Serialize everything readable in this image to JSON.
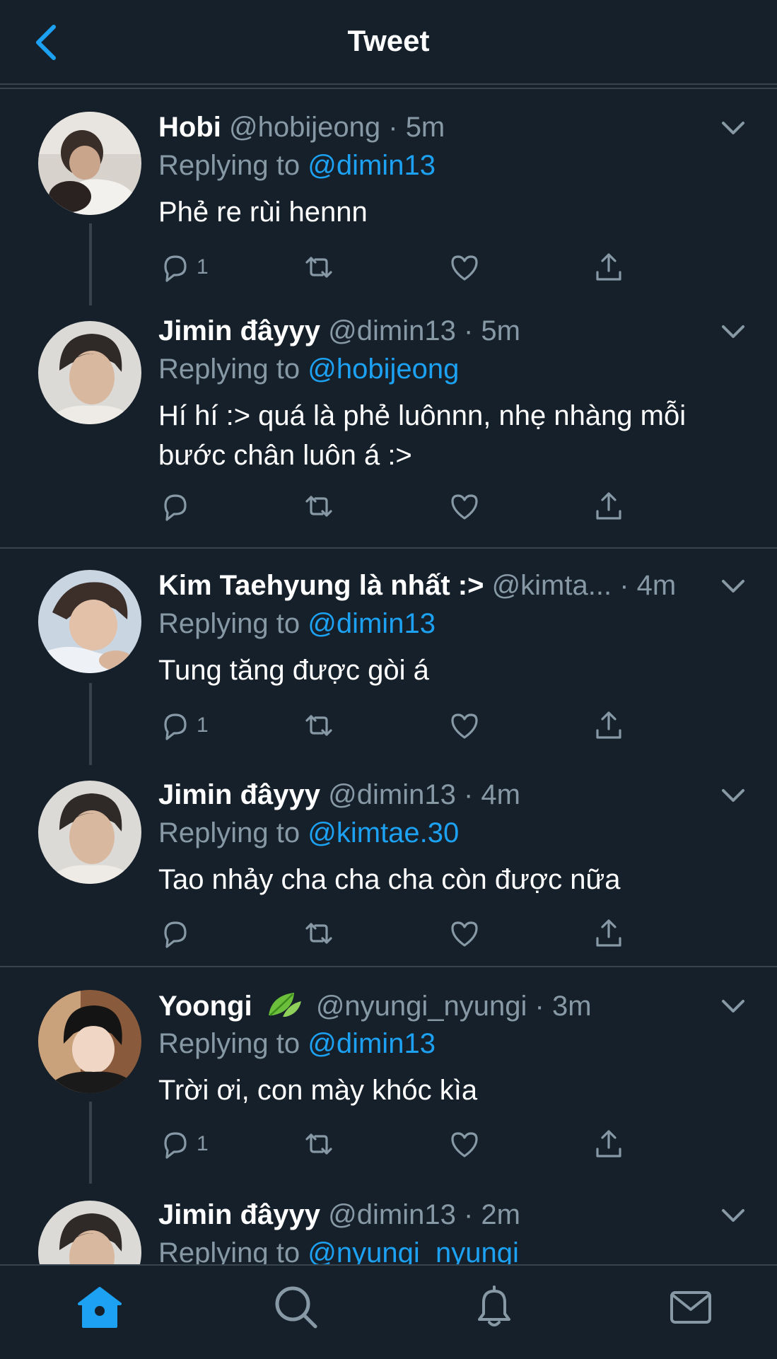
{
  "header": {
    "title": "Tweet"
  },
  "colors": {
    "background": "#15202b",
    "accent": "#1da1f2",
    "muted": "#8899a6",
    "divider": "#38444d"
  },
  "tweets": [
    {
      "name": "Hobi",
      "handle": "@hobijeong",
      "dot": "·",
      "time": "5m",
      "replying_label": "Replying to",
      "reply_to": "@dimin13",
      "text": "Phẻ re rùi hennn",
      "reply_count": "1"
    },
    {
      "name": "Jimin đâyyy",
      "handle": "@dimin13",
      "dot": "·",
      "time": "5m",
      "replying_label": "Replying to",
      "reply_to": "@hobijeong",
      "text": "Hí hí :> quá là phẻ luônnn, nhẹ nhàng mỗi bước chân luôn á :>",
      "reply_count": ""
    },
    {
      "name": "Kim Taehyung là nhất :>",
      "handle": "@kimta...",
      "dot": "·",
      "time": "4m",
      "replying_label": "Replying to",
      "reply_to": "@dimin13",
      "text": "Tung tăng được gòi á",
      "reply_count": "1"
    },
    {
      "name": "Jimin đâyyy",
      "handle": "@dimin13",
      "dot": "·",
      "time": "4m",
      "replying_label": "Replying to",
      "reply_to": "@kimtae.30",
      "text": "Tao nhảy cha cha cha còn được nữa",
      "reply_count": ""
    },
    {
      "name": "Yoongi",
      "handle": "@nyungi_nyungi",
      "dot": "·",
      "time": "3m",
      "replying_label": "Replying to",
      "reply_to": "@dimin13",
      "text": "Trời ơi, con mày khóc kìa",
      "reply_count": "1"
    },
    {
      "name": "Jimin đâyyy",
      "handle": "@dimin13",
      "dot": "·",
      "time": "2m",
      "replying_label": "Replying to",
      "reply_to": "@nyungi_nyungi",
      "text": "",
      "reply_count": ""
    }
  ],
  "icons": {
    "back": "chevron-left-icon",
    "caret": "chevron-down-icon",
    "reply": "reply-icon",
    "retweet": "retweet-icon",
    "like": "heart-icon",
    "share": "share-icon",
    "leaf": "leaf-icon",
    "home": "home-icon",
    "search": "search-icon",
    "notifications": "bell-icon",
    "messages": "mail-icon"
  }
}
